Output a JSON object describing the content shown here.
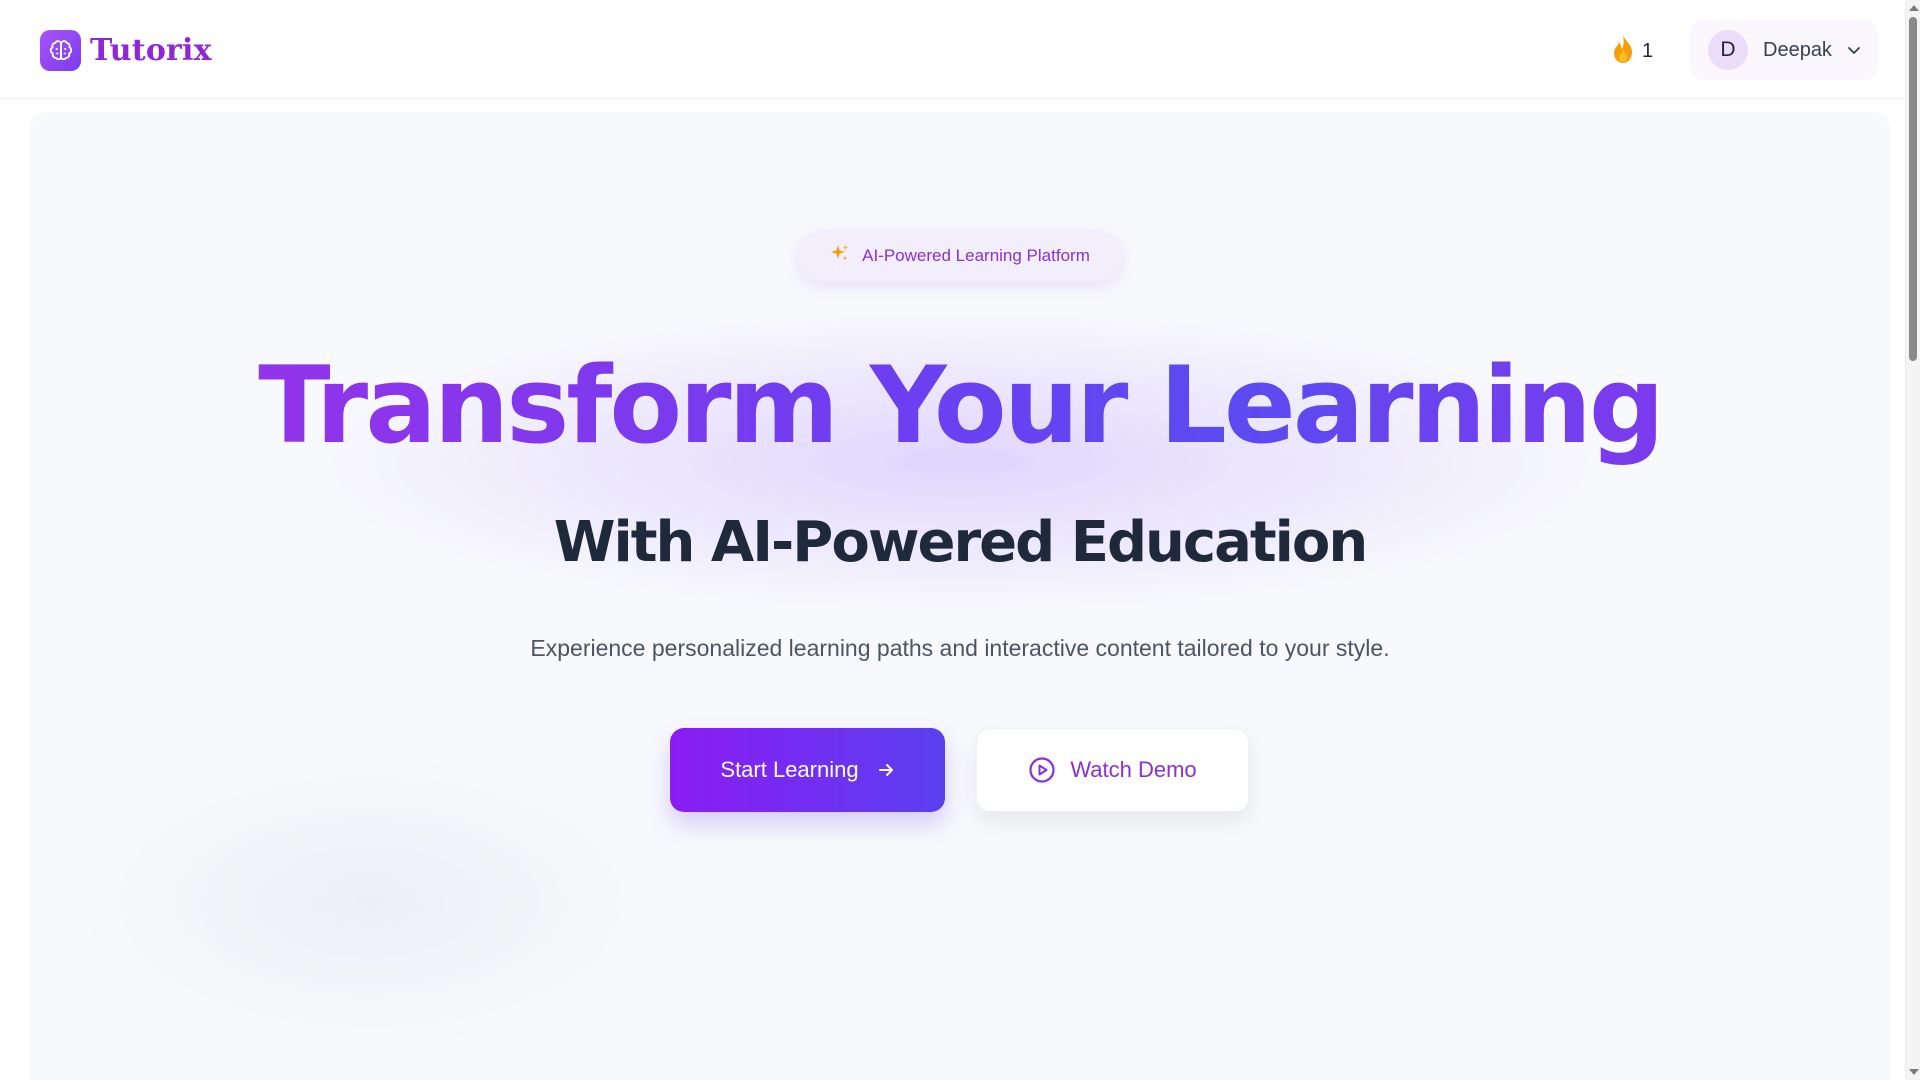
{
  "app": {
    "brand_name": "Tutorix",
    "brand_color": "#9126d9"
  },
  "header": {
    "streak": {
      "icon": "fire-icon",
      "count": "1"
    },
    "user": {
      "avatar_initial": "D",
      "name": "Deepak",
      "menu_icon": "chevron-down-icon"
    }
  },
  "hero": {
    "badge": {
      "icon": "sparkles-icon",
      "label": "AI-Powered Learning Platform"
    },
    "title": "Transform Your Learning",
    "subtitle": "With AI-Powered Education",
    "description": "Experience personalized learning paths and interactive content tailored to your style.",
    "primary_button": {
      "label": "Start Learning",
      "icon": "arrow-right-icon"
    },
    "secondary_button": {
      "label": "Watch Demo",
      "icon": "play-circle-icon"
    }
  },
  "colors": {
    "accent_purple": "#9333ea",
    "accent_indigo": "#5a40f0",
    "heading_dark": "#1e293b",
    "text_muted": "#4b5563",
    "streak_orange": "#f59e0b"
  }
}
